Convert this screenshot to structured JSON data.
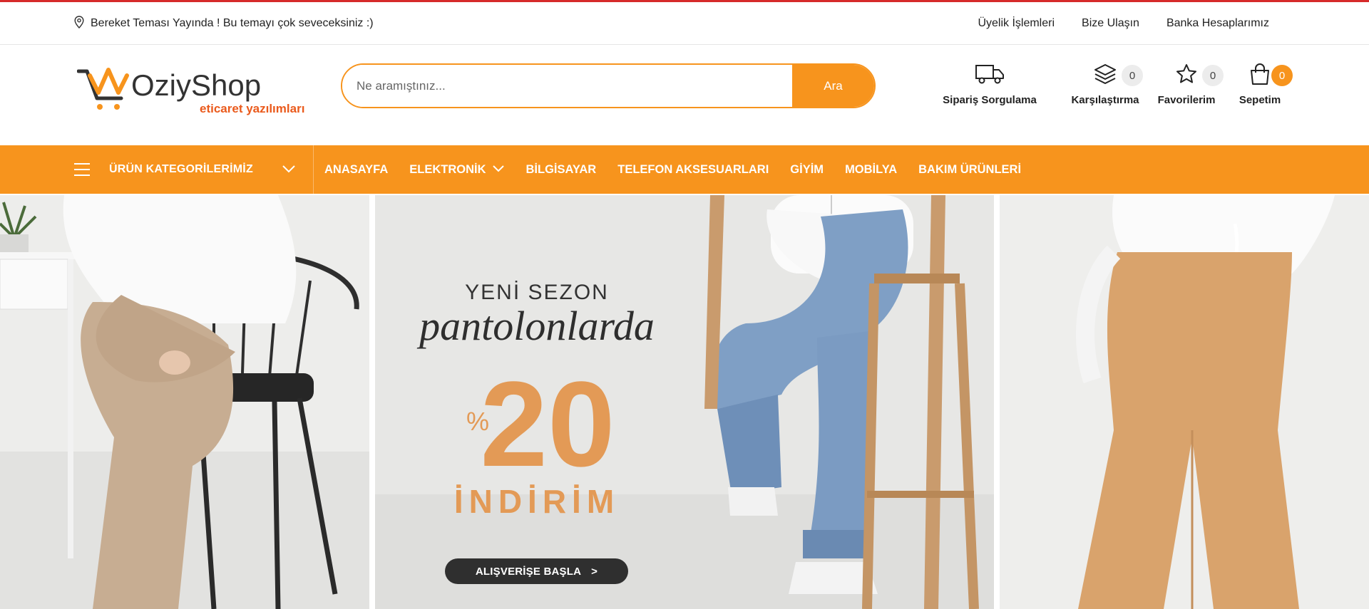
{
  "topbar": {
    "announcement": "Bereket Teması Yayında ! Bu temayı çok seveceksiniz :)",
    "links": [
      "Üyelik İşlemleri",
      "Bize Ulaşın",
      "Banka Hesaplarımız"
    ]
  },
  "logo": {
    "brand": "OziyShop",
    "tagline": "eticaret yazılımları"
  },
  "search": {
    "placeholder": "Ne aramıştınız...",
    "button": "Ara"
  },
  "header_icons": {
    "order": {
      "label": "Sipariş Sorgulama",
      "icon": "truck-icon"
    },
    "compare": {
      "label": "Karşılaştırma",
      "count": "0",
      "icon": "layers-icon"
    },
    "favorites": {
      "label": "Favorilerim",
      "count": "0",
      "icon": "star-icon"
    },
    "cart": {
      "label": "Sepetim",
      "count": "0",
      "icon": "shopping-bag-icon"
    }
  },
  "nav": {
    "categories_label": "ÜRÜN KATEGORİLERİMİZ",
    "items": [
      "ANASAYFA",
      "ELEKTRONİK",
      "BİLGİSAYAR",
      "TELEFON AKSESUARLARI",
      "GİYİM",
      "MOBİLYA",
      "BAKIM ÜRÜNLERİ"
    ]
  },
  "banner": {
    "season": "YENİ SEZON",
    "script": "pantolonlarda",
    "percent": "%",
    "discount": "20",
    "word": "İNDİRİM",
    "cta": "ALIŞVERİŞE BAŞLA",
    "cta_arrow": ">"
  },
  "colors": {
    "accent": "#f7941d",
    "topline": "#d62a2a",
    "discount": "#e39a56",
    "cta_bg": "#2f2f2f"
  }
}
